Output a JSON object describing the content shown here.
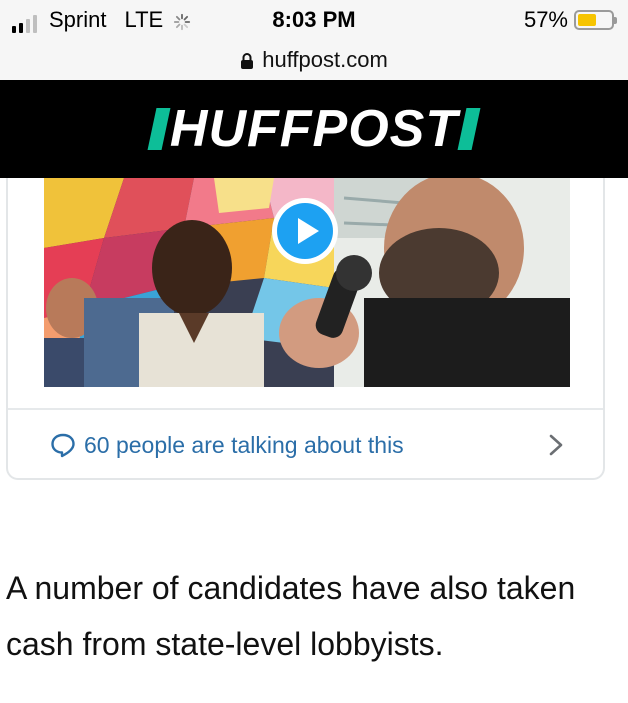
{
  "status_bar": {
    "carrier": "Sprint",
    "network": "LTE",
    "time": "8:03 PM",
    "battery_percent": "57%",
    "battery_level": 0.57,
    "signal_bars_filled": 2,
    "signal_bars_total": 4,
    "battery_color": "#f6c400"
  },
  "url_bar": {
    "domain": "huffpost.com",
    "icon": "lock-icon"
  },
  "header": {
    "logo_text": "HUFFPOST",
    "background": "#000000",
    "accent": "#0dbe98"
  },
  "embed": {
    "play_icon": "play-icon",
    "talking_text": "60 people are talking about this",
    "talking_icon": "speech-bubble-icon",
    "chevron_icon": "chevron-right-icon",
    "link_color": "#2b6ea8"
  },
  "article": {
    "paragraph": "A number of candidates have also taken cash from state-level lobbyists."
  }
}
